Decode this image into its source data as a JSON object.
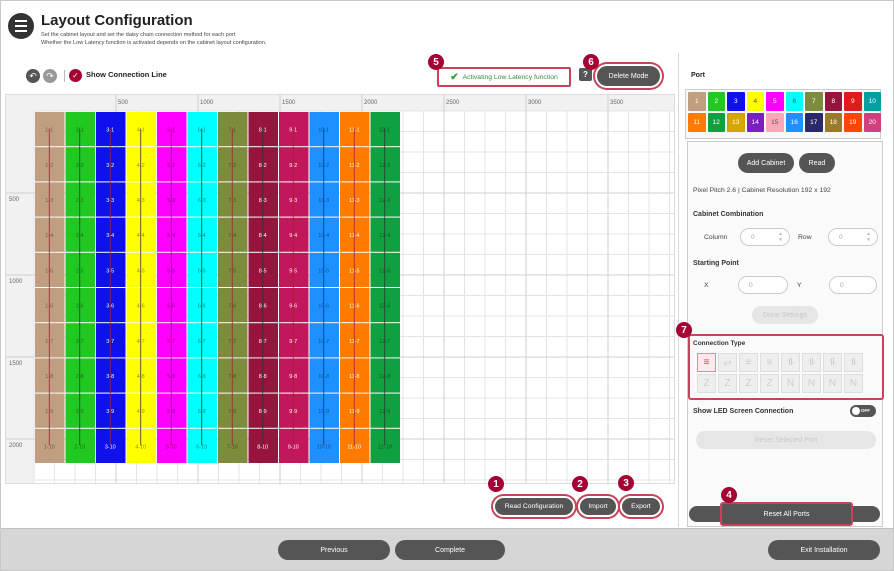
{
  "header": {
    "title": "Layout Configuration",
    "subtitle1": "Set the cabinet layout and set the daisy chain connection method for each port",
    "subtitle2": "Whether the Low Latency function is activated depends on the cabinet layout configuration."
  },
  "toolbar": {
    "show_connection_line": "Show Connection Line",
    "low_latency": "Activating Low Latency function",
    "help": "?",
    "delete_mode": "Delete Mode"
  },
  "grid": {
    "x_ticks": [
      "500",
      "1000",
      "1500",
      "2000",
      "2500",
      "3000",
      "3500"
    ],
    "y_ticks": [
      "500",
      "1000",
      "1500",
      "2000"
    ],
    "columns": [
      {
        "id": 1,
        "color": "#bf9f7f"
      },
      {
        "id": 2,
        "color": "#22c822"
      },
      {
        "id": 3,
        "color": "#1010ee"
      },
      {
        "id": 4,
        "color": "#ffff00"
      },
      {
        "id": 5,
        "color": "#ff00ff"
      },
      {
        "id": 6,
        "color": "#00ffff"
      },
      {
        "id": 7,
        "color": "#7c8c3c"
      },
      {
        "id": 8,
        "color": "#95153c"
      },
      {
        "id": 9,
        "color": "#c2185b"
      },
      {
        "id": 10,
        "color": "#1e90ff"
      },
      {
        "id": 11,
        "color": "#ff7b00"
      },
      {
        "id": 12,
        "color": "#10a040"
      }
    ],
    "rows": 10,
    "light_columns": [
      1,
      2,
      4,
      5,
      6,
      7,
      10,
      12
    ]
  },
  "actions": {
    "read_configuration": "Read Configuration",
    "import": "Import",
    "export": "Export"
  },
  "right_panel": {
    "port_title": "Port",
    "ports": [
      {
        "n": "1",
        "color": "#bf9f7f"
      },
      {
        "n": "2",
        "color": "#22c822"
      },
      {
        "n": "3",
        "color": "#1010ee"
      },
      {
        "n": "4",
        "color": "#ffff00"
      },
      {
        "n": "5",
        "color": "#ff00ff"
      },
      {
        "n": "6",
        "color": "#00ffff"
      },
      {
        "n": "7",
        "color": "#7c8c3c"
      },
      {
        "n": "8",
        "color": "#95153c"
      },
      {
        "n": "9",
        "color": "#e31a1c"
      },
      {
        "n": "10",
        "color": "#00a0a0"
      },
      {
        "n": "11",
        "color": "#ff7b00"
      },
      {
        "n": "12",
        "color": "#10a040"
      },
      {
        "n": "13",
        "color": "#d4a800"
      },
      {
        "n": "14",
        "color": "#7a1fc0"
      },
      {
        "n": "15",
        "color": "#f9a8b8"
      },
      {
        "n": "16",
        "color": "#1e90ff"
      },
      {
        "n": "17",
        "color": "#2a2a6a"
      },
      {
        "n": "18",
        "color": "#9a7a2a"
      },
      {
        "n": "19",
        "color": "#ff4500"
      },
      {
        "n": "20",
        "color": "#d04080"
      }
    ],
    "selected_port": "13",
    "add_cabinet": "Add Cabinet",
    "read": "Read",
    "pixel_info": "Pixel Pitch 2.6 | Cabinet Resolution 192 x 192",
    "cabinet_combination": "Cabinet Combination",
    "column_label": "Column",
    "column_value": "0",
    "row_label": "Row",
    "row_value": "0",
    "starting_point": "Starting Point",
    "x_label": "X",
    "x_value": "0",
    "y_label": "Y",
    "y_value": "0",
    "done_settings": "Done Settings",
    "connection_type": "Connection Type",
    "connection_icons": [
      "≡",
      "⥂",
      "≡",
      "≡",
      "⥮",
      "⥮",
      "⥮",
      "⥮",
      "Z",
      "Z",
      "Z",
      "Z",
      "N",
      "N",
      "N",
      "N"
    ],
    "show_led": "Show LED Screen Connection",
    "toggle_state": "OFF",
    "reset_selected": "Reset Selected Port",
    "reset_all": "Reset All Ports"
  },
  "footer": {
    "previous": "Previous",
    "complete": "Complete",
    "exit": "Exit Installation"
  },
  "badges": {
    "b1": "1",
    "b2": "2",
    "b3": "3",
    "b4": "4",
    "b5": "5",
    "b6": "6",
    "b7": "7"
  }
}
